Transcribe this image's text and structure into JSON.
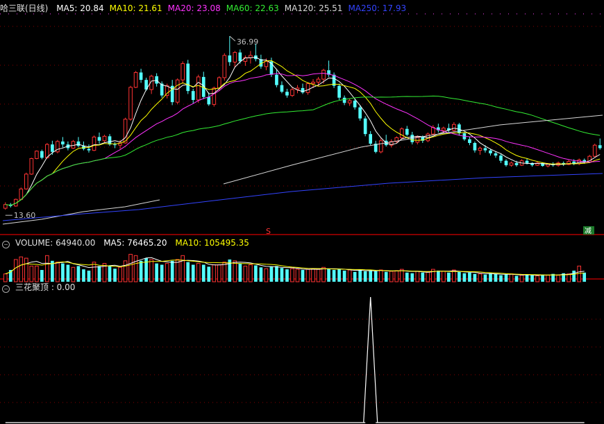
{
  "header": {
    "title": "哈三联(日线)",
    "ma": [
      {
        "label": "MA5: 20.84",
        "color": "#ffffff"
      },
      {
        "label": "MA10: 21.61",
        "color": "#ffff00"
      },
      {
        "label": "MA20: 23.08",
        "color": "#ff33ff"
      },
      {
        "label": "MA60: 22.63",
        "color": "#33ee33"
      },
      {
        "label": "MA120: 25.51",
        "color": "#d8d8d8"
      },
      {
        "label": "MA250: 17.93",
        "color": "#3344ff"
      }
    ]
  },
  "volume_header": {
    "label": "VOLUME: 64940.00",
    "ma5": "MA5: 76465.20",
    "ma10": "MA10: 105495.35"
  },
  "indicator_header": {
    "label": "三花聚顶 : 0.00"
  },
  "annotations": {
    "high": "36.99",
    "low": "13.60",
    "marker_s": "S",
    "marker_jian": "减"
  },
  "colors": {
    "up": "#ff3333",
    "down": "#54ffff",
    "grid": "#8a0000"
  },
  "chart_data": [
    {
      "type": "candlestick",
      "ylim": [
        11,
        40
      ],
      "ohlc": [
        [
          13.8,
          14.6,
          13.6,
          14.3
        ],
        [
          14.3,
          14.5,
          13.9,
          14.1
        ],
        [
          14.1,
          15.1,
          14.0,
          15.0
        ],
        [
          15.0,
          16.6,
          14.9,
          16.4
        ],
        [
          16.4,
          18.6,
          16.3,
          18.4
        ],
        [
          18.4,
          20.6,
          18.3,
          20.5
        ],
        [
          20.5,
          21.6,
          20.4,
          21.5
        ],
        [
          21.5,
          21.7,
          20.4,
          20.6
        ],
        [
          20.6,
          22.6,
          20.5,
          22.4
        ],
        [
          22.4,
          22.9,
          21.0,
          21.4
        ],
        [
          21.4,
          23.0,
          21.2,
          22.8
        ],
        [
          22.8,
          23.4,
          22.0,
          22.4
        ],
        [
          22.4,
          22.8,
          21.6,
          21.9
        ],
        [
          21.9,
          23.0,
          21.8,
          22.8
        ],
        [
          22.8,
          23.4,
          22.0,
          22.2
        ],
        [
          22.2,
          22.8,
          21.6,
          21.8
        ],
        [
          21.8,
          22.4,
          21.3,
          21.6
        ],
        [
          21.6,
          23.6,
          21.5,
          23.4
        ],
        [
          23.4,
          24.0,
          22.5,
          22.9
        ],
        [
          22.9,
          23.7,
          22.7,
          23.5
        ],
        [
          23.5,
          23.8,
          22.2,
          22.4
        ],
        [
          22.4,
          22.7,
          21.9,
          22.3
        ],
        [
          22.3,
          23.0,
          21.8,
          22.6
        ],
        [
          22.6,
          26.0,
          22.5,
          25.8
        ],
        [
          25.8,
          30.3,
          25.6,
          30.1
        ],
        [
          30.1,
          32.3,
          30.0,
          32.1
        ],
        [
          32.1,
          32.6,
          30.7,
          31.1
        ],
        [
          31.1,
          31.4,
          29.6,
          29.8
        ],
        [
          29.8,
          31.8,
          29.2,
          31.6
        ],
        [
          31.6,
          32.0,
          30.2,
          30.6
        ],
        [
          30.6,
          30.9,
          28.7,
          29.0
        ],
        [
          29.0,
          30.6,
          28.6,
          30.3
        ],
        [
          30.3,
          31.1,
          27.7,
          28.1
        ],
        [
          28.1,
          31.3,
          27.8,
          31.1
        ],
        [
          31.1,
          33.6,
          30.6,
          33.3
        ],
        [
          33.3,
          33.8,
          29.2,
          29.6
        ],
        [
          29.6,
          29.9,
          27.9,
          28.4
        ],
        [
          28.4,
          31.8,
          28.0,
          31.5
        ],
        [
          31.5,
          32.2,
          28.5,
          28.8
        ],
        [
          28.8,
          29.4,
          27.6,
          27.8
        ],
        [
          27.8,
          30.2,
          27.5,
          30.0
        ],
        [
          30.0,
          31.6,
          29.6,
          31.4
        ],
        [
          31.4,
          34.7,
          31.0,
          34.4
        ],
        [
          34.4,
          37.0,
          33.0,
          33.5
        ],
        [
          33.5,
          35.0,
          32.8,
          34.8
        ],
        [
          34.8,
          35.2,
          33.3,
          33.6
        ],
        [
          33.6,
          34.4,
          33.0,
          34.1
        ],
        [
          34.1,
          35.0,
          33.3,
          34.4
        ],
        [
          34.4,
          36.0,
          33.6,
          33.9
        ],
        [
          33.9,
          34.5,
          32.6,
          32.9
        ],
        [
          32.9,
          34.0,
          32.4,
          33.6
        ],
        [
          33.6,
          34.1,
          31.5,
          31.8
        ],
        [
          31.8,
          32.5,
          30.1,
          30.4
        ],
        [
          30.4,
          30.9,
          29.3,
          29.5
        ],
        [
          29.5,
          29.9,
          28.7,
          29.0
        ],
        [
          29.0,
          30.1,
          28.8,
          29.8
        ],
        [
          29.8,
          30.4,
          29.3,
          30.0
        ],
        [
          30.0,
          30.6,
          29.2,
          29.4
        ],
        [
          29.4,
          30.8,
          29.1,
          30.6
        ],
        [
          30.6,
          31.2,
          30.0,
          30.8
        ],
        [
          30.8,
          31.5,
          30.3,
          31.2
        ],
        [
          31.2,
          32.6,
          30.6,
          32.4
        ],
        [
          32.4,
          33.7,
          31.5,
          31.8
        ],
        [
          31.8,
          32.1,
          30.0,
          30.3
        ],
        [
          30.3,
          30.6,
          28.4,
          28.7
        ],
        [
          28.7,
          29.0,
          27.7,
          28.0
        ],
        [
          28.0,
          28.6,
          27.6,
          28.3
        ],
        [
          28.3,
          28.6,
          27.1,
          27.4
        ],
        [
          27.4,
          27.7,
          25.6,
          25.9
        ],
        [
          25.9,
          26.2,
          23.5,
          23.8
        ],
        [
          23.8,
          24.2,
          22.3,
          22.5
        ],
        [
          22.5,
          22.9,
          21.2,
          21.4
        ],
        [
          21.4,
          23.2,
          21.2,
          22.9
        ],
        [
          22.9,
          23.7,
          22.1,
          22.3
        ],
        [
          22.3,
          23.1,
          22.0,
          22.8
        ],
        [
          22.8,
          23.5,
          22.6,
          23.3
        ],
        [
          23.3,
          24.7,
          23.1,
          24.5
        ],
        [
          24.5,
          24.9,
          23.5,
          23.7
        ],
        [
          23.7,
          24.1,
          22.4,
          22.7
        ],
        [
          22.7,
          23.6,
          22.4,
          23.4
        ],
        [
          23.4,
          23.6,
          22.6,
          22.9
        ],
        [
          22.9,
          24.0,
          22.7,
          23.8
        ],
        [
          23.8,
          25.0,
          23.6,
          24.7
        ],
        [
          24.7,
          25.2,
          24.0,
          24.3
        ],
        [
          24.3,
          24.8,
          23.9,
          24.6
        ],
        [
          24.6,
          25.2,
          24.0,
          24.3
        ],
        [
          24.3,
          25.4,
          24.1,
          25.1
        ],
        [
          25.1,
          25.3,
          23.6,
          23.9
        ],
        [
          23.9,
          24.1,
          22.9,
          23.1
        ],
        [
          23.1,
          23.4,
          22.3,
          22.6
        ],
        [
          22.6,
          22.8,
          21.3,
          21.6
        ],
        [
          21.6,
          22.1,
          21.0,
          21.9
        ],
        [
          21.9,
          22.3,
          21.3,
          21.6
        ],
        [
          21.6,
          21.8,
          20.9,
          21.2
        ],
        [
          21.2,
          21.5,
          20.6,
          20.9
        ],
        [
          20.9,
          21.2,
          19.9,
          20.2
        ],
        [
          20.2,
          20.4,
          19.4,
          19.6
        ],
        [
          19.6,
          20.1,
          19.4,
          19.9
        ],
        [
          19.9,
          20.2,
          19.4,
          19.6
        ],
        [
          19.6,
          20.4,
          19.5,
          20.2
        ],
        [
          20.2,
          20.5,
          19.7,
          19.9
        ],
        [
          19.9,
          20.0,
          19.4,
          19.6
        ],
        [
          19.6,
          20.1,
          19.5,
          19.9
        ],
        [
          19.9,
          20.0,
          19.4,
          19.5
        ],
        [
          19.5,
          19.9,
          19.3,
          19.8
        ],
        [
          19.8,
          20.0,
          19.4,
          19.6
        ],
        [
          19.6,
          20.1,
          19.4,
          19.9
        ],
        [
          19.9,
          20.1,
          19.5,
          19.7
        ],
        [
          19.7,
          20.3,
          19.6,
          20.1
        ],
        [
          20.1,
          20.4,
          19.6,
          19.8
        ],
        [
          19.8,
          20.5,
          19.6,
          20.3
        ],
        [
          20.3,
          20.5,
          19.8,
          20.0
        ],
        [
          20.0,
          21.0,
          19.9,
          20.8
        ],
        [
          20.8,
          22.5,
          20.7,
          22.3
        ],
        [
          22.3,
          23.2,
          21.7,
          21.9
        ]
      ]
    },
    {
      "type": "bar",
      "title": "VOLUME",
      "ylim": [
        0,
        260000
      ],
      "values": [
        60000,
        90000,
        170000,
        190000,
        180000,
        120000,
        120000,
        90000,
        200000,
        160000,
        150000,
        140000,
        130000,
        110000,
        120000,
        95000,
        85000,
        150000,
        120000,
        140000,
        120000,
        100000,
        110000,
        160000,
        210000,
        200000,
        160000,
        180000,
        170000,
        140000,
        130000,
        140000,
        160000,
        170000,
        200000,
        150000,
        130000,
        140000,
        130000,
        115000,
        130000,
        130000,
        150000,
        170000,
        160000,
        140000,
        120000,
        130000,
        125000,
        110000,
        100000,
        115000,
        120000,
        105000,
        95000,
        100000,
        95000,
        90000,
        95000,
        100000,
        95000,
        110000,
        100000,
        90000,
        95000,
        85000,
        90000,
        75000,
        95000,
        80000,
        85000,
        80000,
        90000,
        75000,
        80000,
        85000,
        95000,
        70000,
        65000,
        80000,
        70000,
        75000,
        95000,
        85000,
        80000,
        70000,
        90000,
        75000,
        65000,
        70000,
        60000,
        60000,
        55000,
        65000,
        60000,
        50000,
        55000,
        60000,
        45000,
        50000,
        55000,
        50000,
        45000,
        55000,
        50000,
        60000,
        50000,
        65000,
        60000,
        85000,
        120000,
        70000
      ]
    },
    {
      "type": "line",
      "title": "三花聚顶",
      "ylim": [
        0,
        1
      ],
      "values": [
        0,
        0,
        0,
        0,
        0,
        0,
        0,
        0,
        0,
        0,
        0,
        0,
        0,
        0,
        0,
        0,
        0,
        0,
        0,
        0,
        0,
        0,
        0,
        0,
        0,
        0,
        0,
        0,
        0,
        0,
        0,
        0,
        0,
        0,
        0,
        0,
        0,
        0,
        0,
        0,
        0,
        0,
        0,
        0,
        0,
        0,
        0,
        0,
        0,
        0,
        0,
        0,
        0,
        0,
        0,
        0,
        0,
        0,
        0,
        0,
        0,
        0,
        0,
        0,
        0,
        0,
        0,
        0,
        0,
        0,
        1,
        0,
        0,
        0,
        0,
        0,
        0,
        0,
        0,
        0,
        0,
        0,
        0,
        0,
        0,
        0,
        0,
        0,
        0,
        0,
        0,
        0,
        0,
        0,
        0,
        0,
        0,
        0,
        0,
        0,
        0,
        0,
        0,
        0,
        0,
        0,
        0,
        0,
        0,
        0,
        0,
        0
      ]
    }
  ]
}
